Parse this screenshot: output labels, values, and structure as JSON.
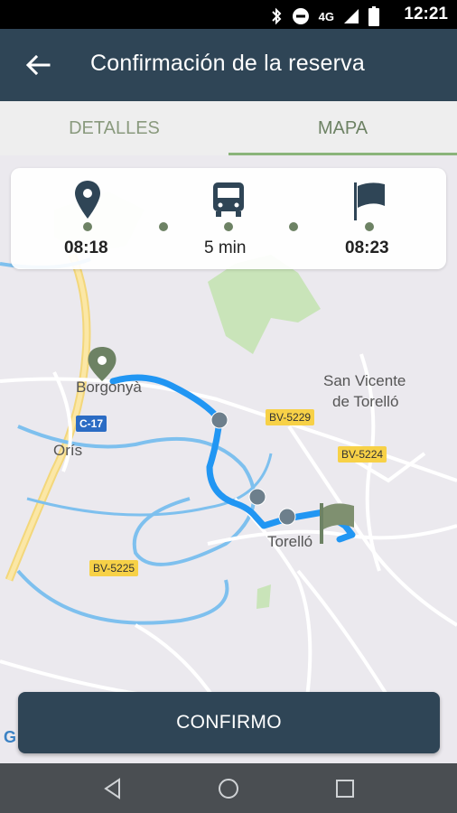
{
  "status_bar": {
    "time": "12:21",
    "network": "4G",
    "icons": [
      "bluetooth-icon",
      "do-not-disturb-icon",
      "signal-icon",
      "battery-icon"
    ]
  },
  "app_bar": {
    "title": "Confirmación de la reserva",
    "back_icon": "arrow-left-icon"
  },
  "tabs": [
    {
      "label": "DETALLES",
      "active": false
    },
    {
      "label": "MAPA",
      "active": true
    }
  ],
  "route_summary": {
    "departure_time": "08:18",
    "duration": "5 min",
    "arrival_time": "08:23",
    "icons": [
      "location-pin-icon",
      "bus-icon",
      "flag-icon"
    ]
  },
  "map": {
    "places": [
      "Borgonyà",
      "San Vicente",
      "de Torelló",
      "Orís",
      "Torelló"
    ],
    "roads": [
      "C-17",
      "BV-5229",
      "BV-5224",
      "BV-5225"
    ],
    "attribution": "G"
  },
  "confirm_button": {
    "label": "CONFIRMO"
  },
  "nav_bar": {
    "icons": [
      "back-triangle-icon",
      "home-circle-icon",
      "recents-square-icon"
    ]
  },
  "colors": {
    "primary": "#2f4556",
    "accent_green": "#6d8264",
    "route_blue": "#2196f3"
  }
}
